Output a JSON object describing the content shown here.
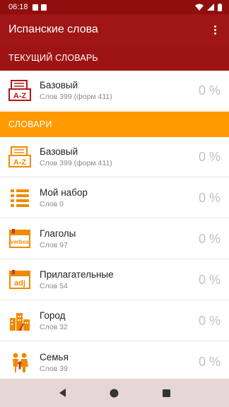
{
  "status": {
    "time": "06:18"
  },
  "app": {
    "title": "Испанские слова"
  },
  "sections": {
    "current": "ТЕКУЩИЙ СЛОВАРЬ",
    "dictionaries": "СЛОВАРИ"
  },
  "current_dictionary": {
    "name": "Базовый",
    "sub": "Слов 399 (форм 411)",
    "percent": "0 %",
    "icon": "a-z-icon"
  },
  "dictionaries": [
    {
      "name": "Базовый",
      "sub": "Слов 399 (форм 411)",
      "percent": "0 %",
      "icon": "a-z-icon"
    },
    {
      "name": "Мой набор",
      "sub": "Слов 0",
      "percent": "0 %",
      "icon": "list-icon"
    },
    {
      "name": "Глаголы",
      "sub": "Слов 97",
      "percent": "0 %",
      "icon": "verbos-icon",
      "icon_text": "verbos"
    },
    {
      "name": "Прилагательные",
      "sub": "Слов 54",
      "percent": "0 %",
      "icon": "adj-icon",
      "icon_text": "adj"
    },
    {
      "name": "Город",
      "sub": "Слов 32",
      "percent": "0 %",
      "icon": "city-icon"
    },
    {
      "name": "Семья",
      "sub": "Слов 39",
      "percent": "0 %",
      "icon": "family-icon"
    }
  ],
  "colors": {
    "statusbar": "#8f0f0f",
    "appbar": "#a01515",
    "current_header": "#9e1414",
    "dict_header": "#ff9a00",
    "current_icon": "#b01818",
    "dict_icon": "#f08a00"
  }
}
